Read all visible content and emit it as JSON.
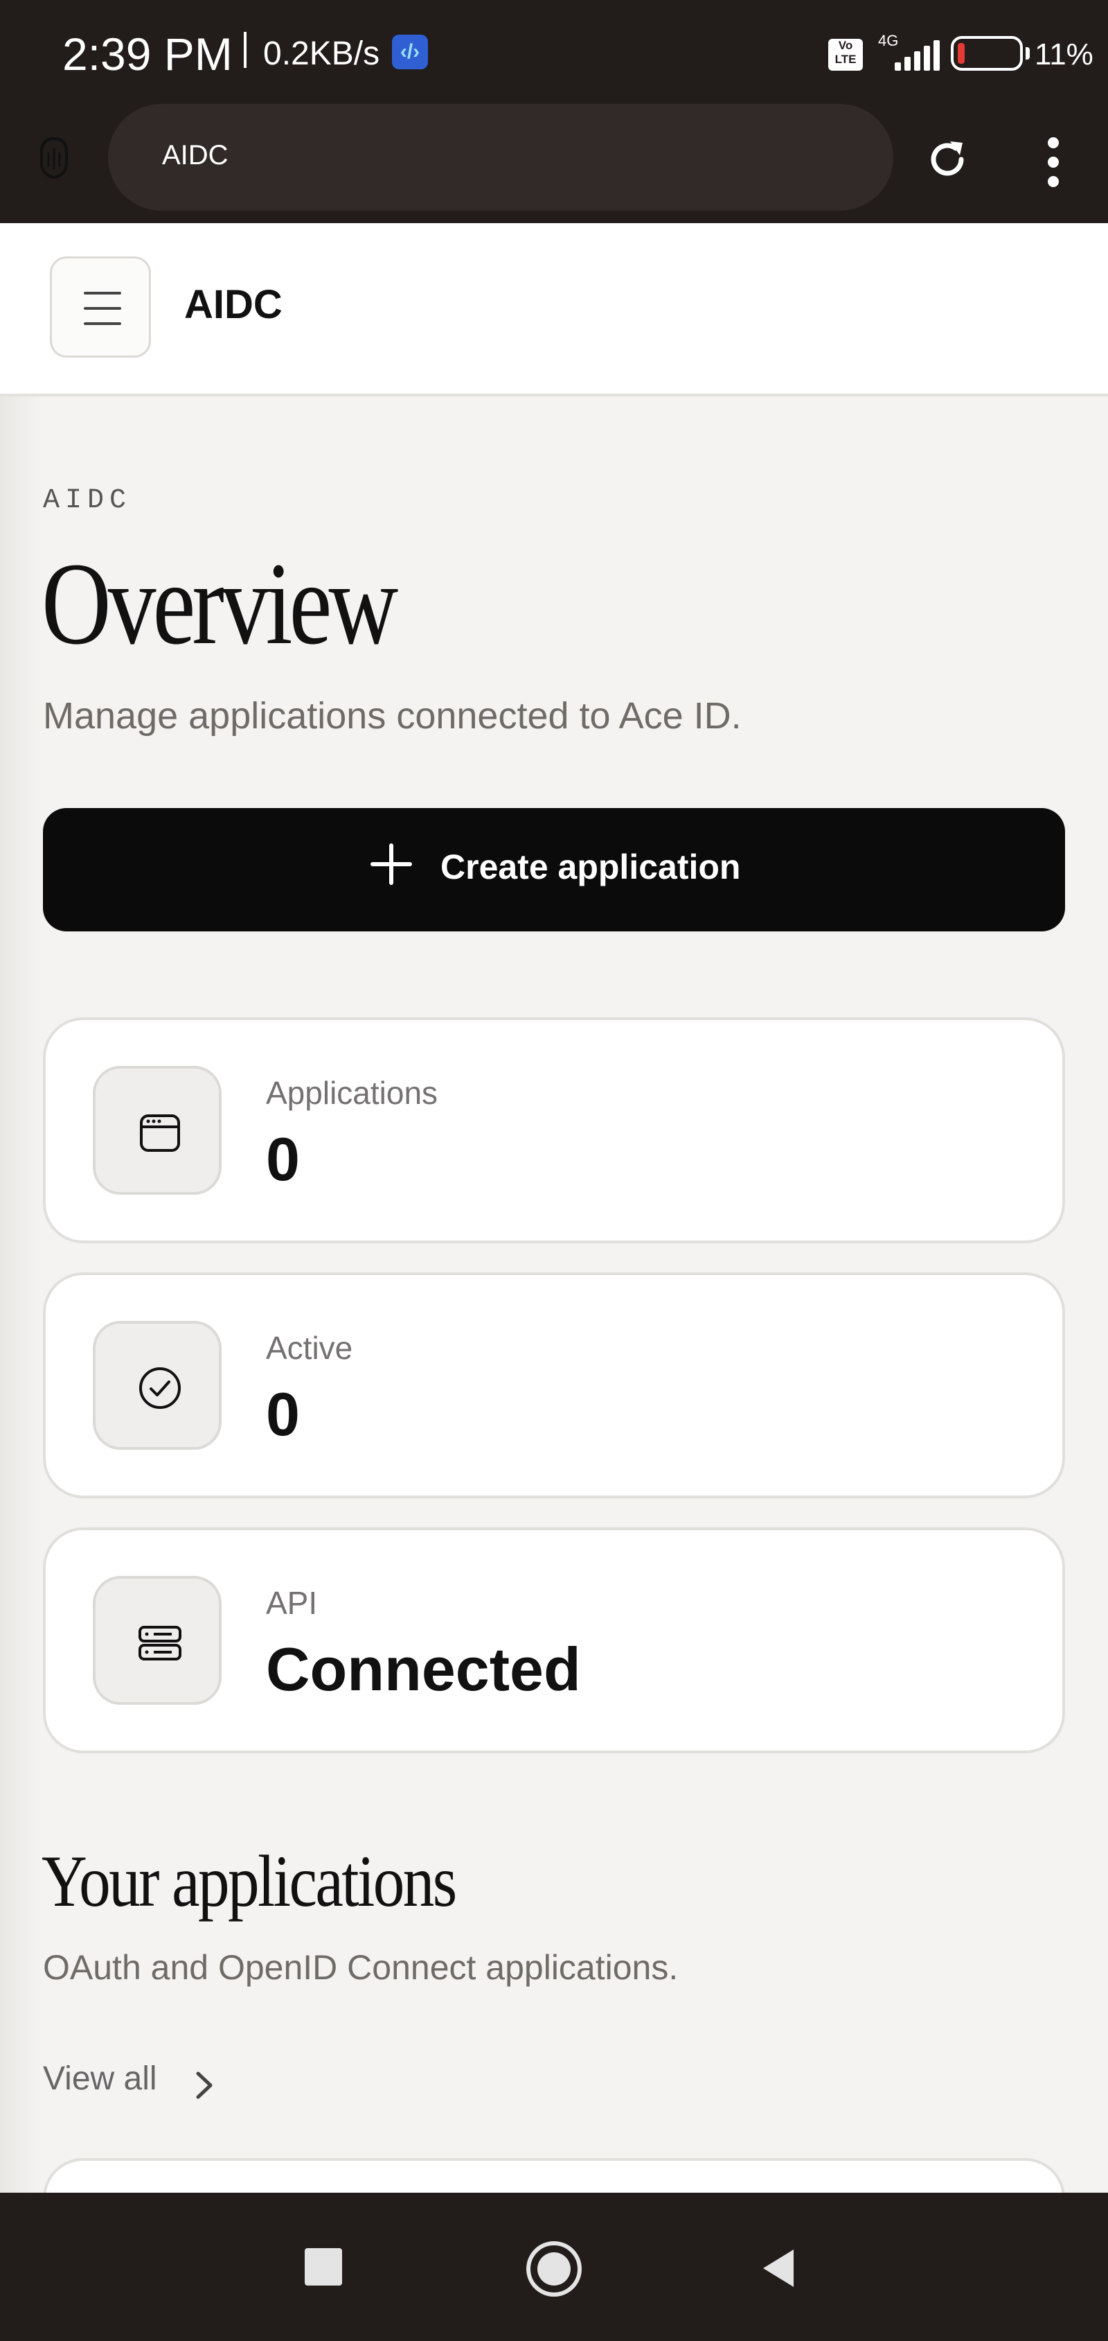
{
  "status_bar": {
    "time": "2:39 PM",
    "net_speed": "0.2KB/s",
    "app_badge": "‹/›",
    "volte": "Vo LTE",
    "network": "4G",
    "battery_pct": "11%",
    "battery_level": 0.11
  },
  "browser": {
    "url": "AIDC",
    "site_icon": "lock-shield-icon",
    "reload_icon": "reload-icon",
    "menu_icon": "overflow-menu-icon"
  },
  "app_header": {
    "menu_icon": "hamburger-icon",
    "title": "AIDC"
  },
  "overview": {
    "eyebrow": "AIDC",
    "title": "Overview",
    "subtitle": "Manage applications connected to Ace ID.",
    "create_button": "Create application"
  },
  "stats": [
    {
      "label": "Applications",
      "value": "0",
      "icon": "window-icon"
    },
    {
      "label": "Active",
      "value": "0",
      "icon": "check-circle-icon"
    },
    {
      "label": "API",
      "value": "Connected",
      "icon": "server-icon"
    }
  ],
  "your_apps": {
    "title": "Your applications",
    "subtitle": "OAuth and OpenID Connect applications.",
    "view_all": "View all"
  },
  "colors": {
    "system_bar": "#221c1b",
    "page_bg": "#f4f3f1",
    "primary_button": "#0b0b0b",
    "battery_low": "#e33b34"
  }
}
